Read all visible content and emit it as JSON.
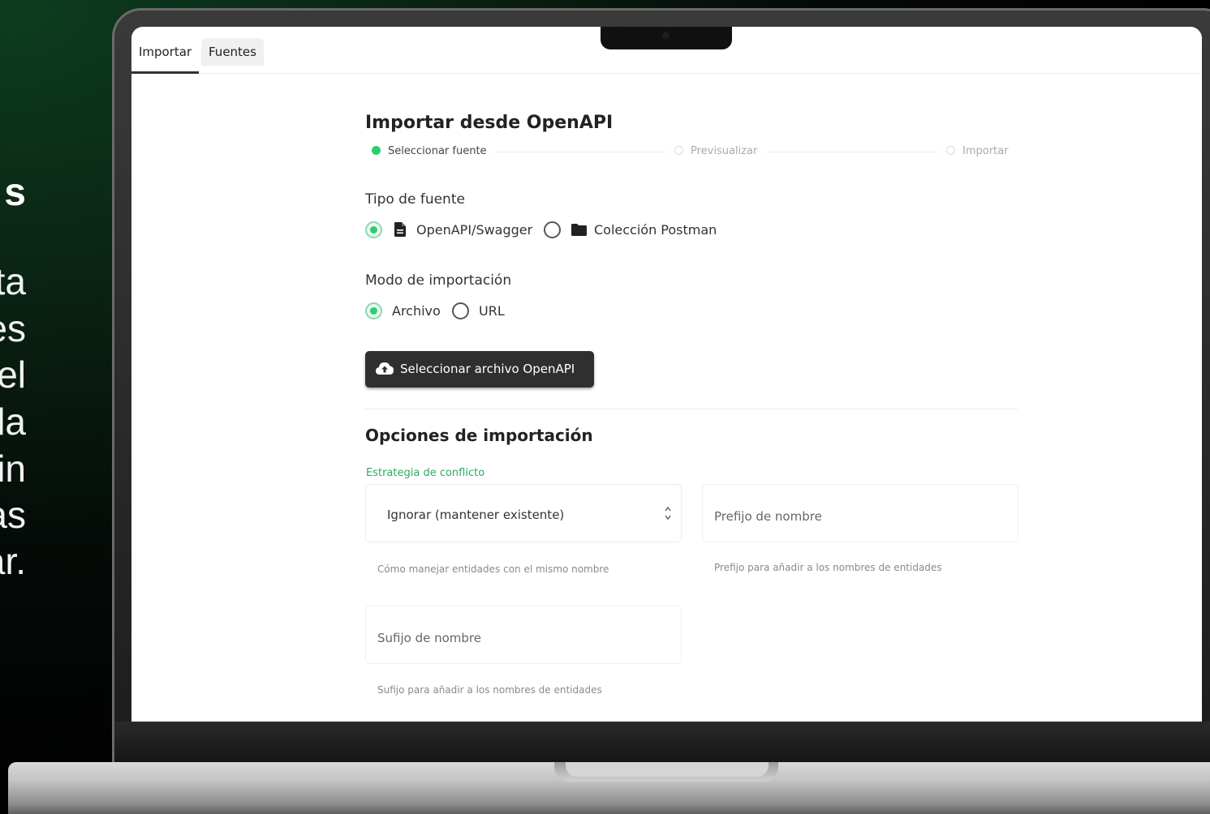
{
  "tabs": [
    {
      "label": "Importar"
    },
    {
      "label": "Fuentes"
    }
  ],
  "title": "Importar desde OpenAPI",
  "stepper": {
    "steps": [
      {
        "label": "Seleccionar fuente",
        "state": "active"
      },
      {
        "label": "Previsualizar",
        "state": "pending"
      },
      {
        "label": "Importar",
        "state": "pending"
      }
    ]
  },
  "source_type": {
    "label": "Tipo de fuente",
    "options": [
      {
        "label": "OpenAPI/Swagger",
        "icon": "file-icon",
        "selected": true
      },
      {
        "label": "Colección Postman",
        "icon": "folder-icon",
        "selected": false
      }
    ]
  },
  "import_mode": {
    "label": "Modo de importación",
    "options": [
      {
        "label": "Archivo",
        "selected": true
      },
      {
        "label": "URL",
        "selected": false
      }
    ]
  },
  "upload_button": {
    "label": "Seleccionar archivo OpenAPI",
    "icon": "cloud-upload-icon"
  },
  "options_section": {
    "title": "Opciones de importación",
    "conflict_strategy": {
      "label": "Estrategia de conflicto",
      "value": "Ignorar (mantener existente)",
      "helper": "Cómo manejar entidades con el mismo nombre"
    },
    "name_prefix": {
      "placeholder": "Prefijo de nombre",
      "helper": "Prefijo para añadir a los nombres de entidades"
    },
    "name_suffix": {
      "placeholder": "Sufijo de nombre",
      "helper": "Sufijo para añadir a los nombres de entidades"
    }
  },
  "side_text": {
    "heading": "s",
    "lines": [
      "ta",
      "es",
      "el",
      "la",
      "in",
      "as",
      "ar."
    ]
  },
  "colors": {
    "accent": "#2ecc71",
    "accent_text": "#2eaa5d",
    "button_bg": "#2f2f2f"
  }
}
